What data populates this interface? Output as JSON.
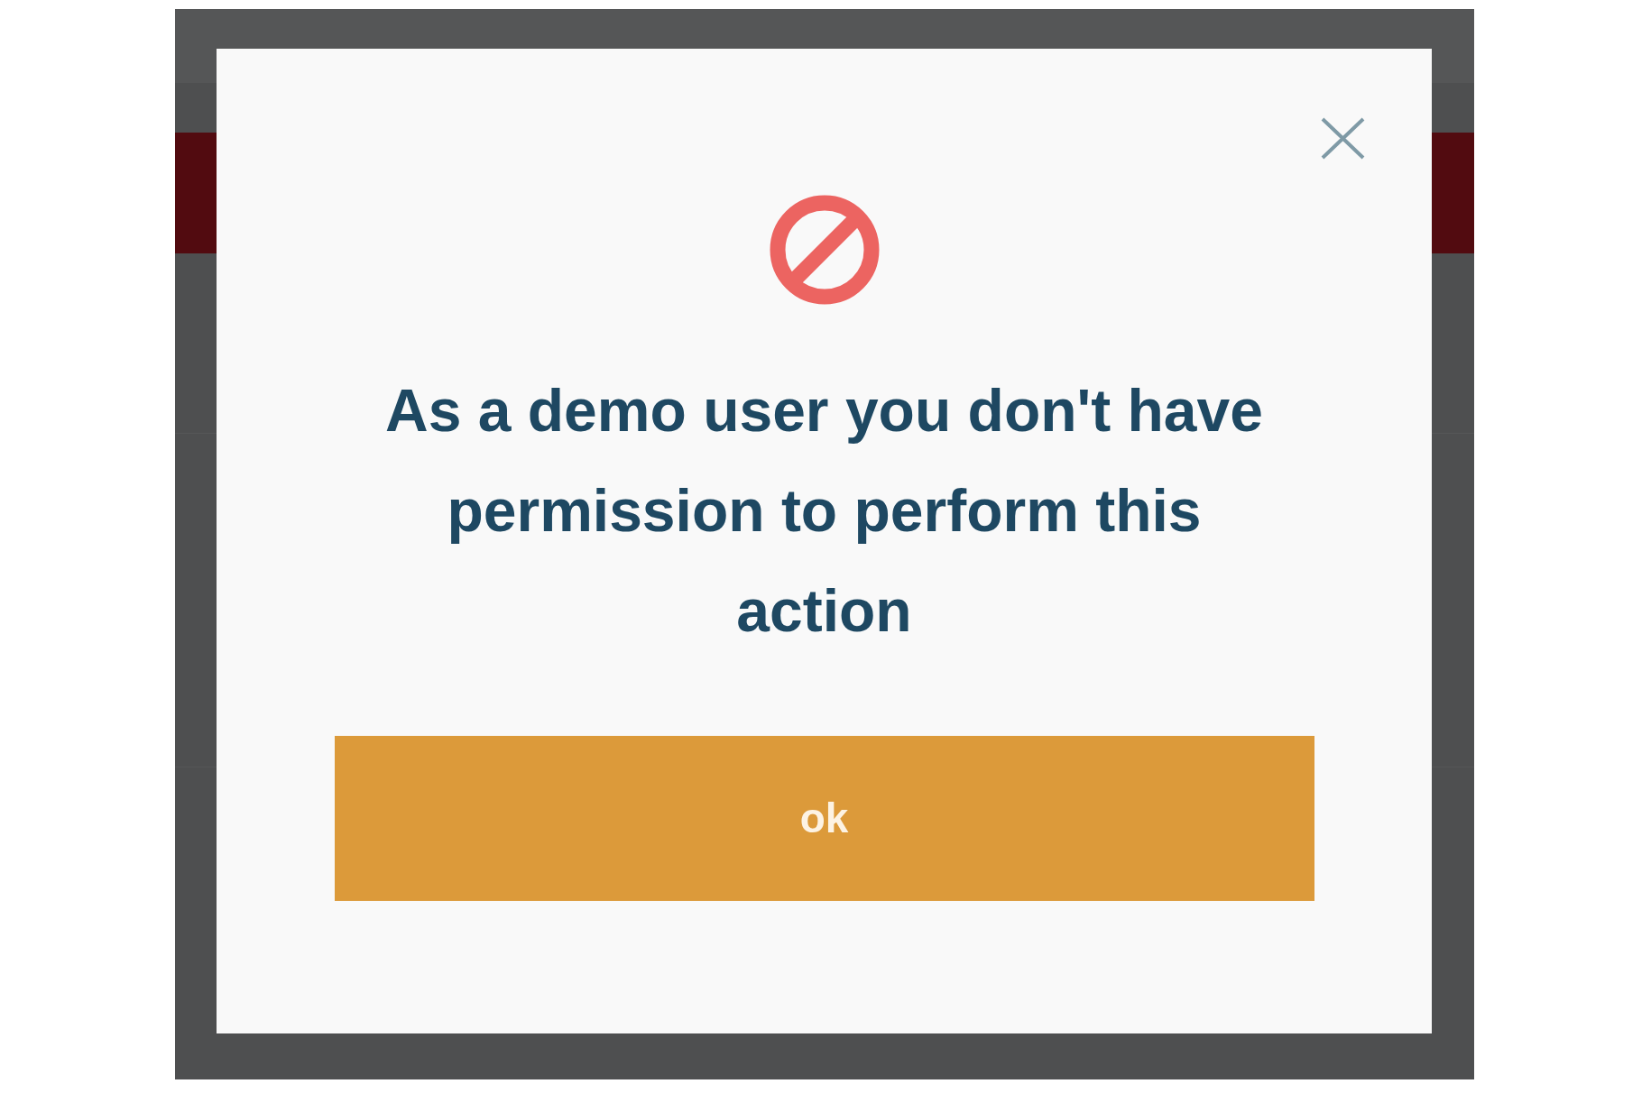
{
  "dialog": {
    "message": "As a demo user you don't have permission to perform this action",
    "button": "ok"
  }
}
